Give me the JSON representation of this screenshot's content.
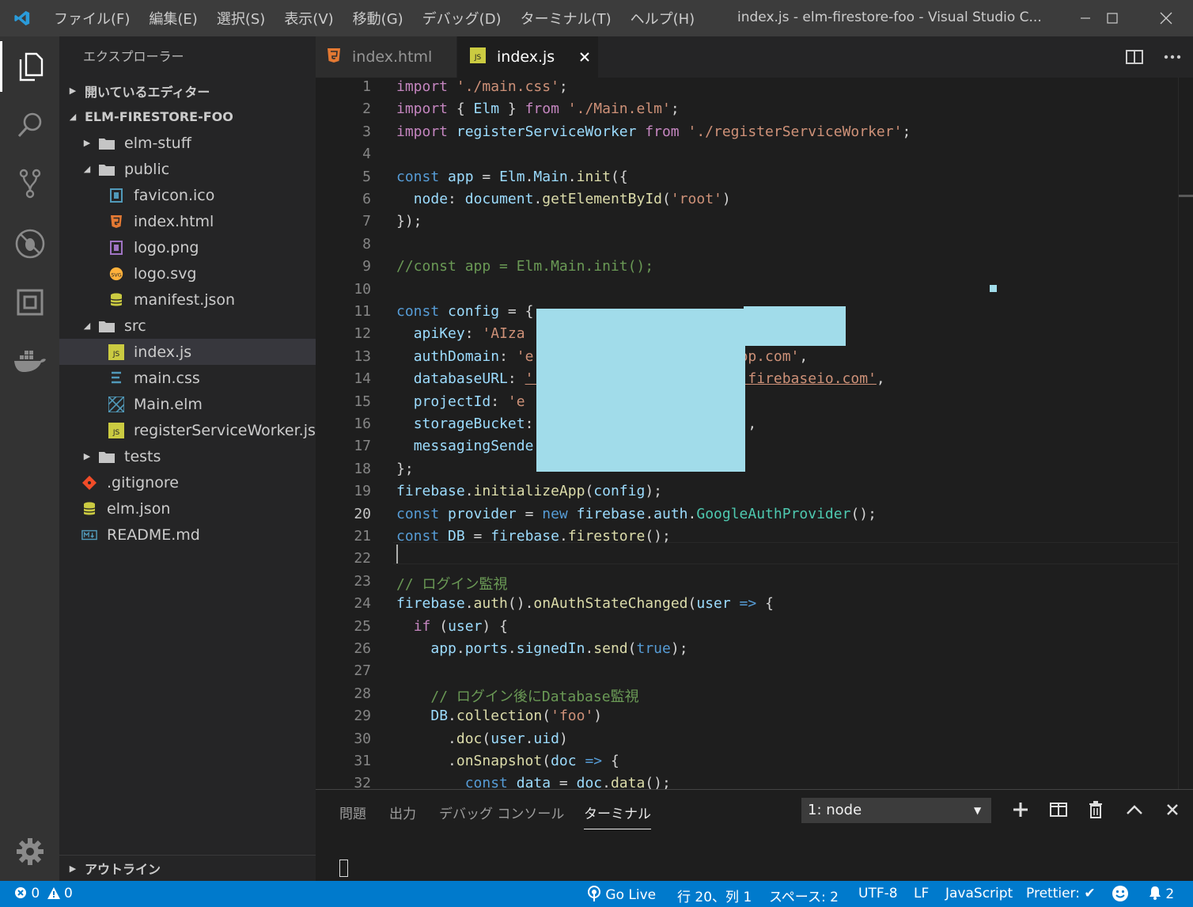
{
  "titlebar": {
    "menu": [
      "ファイル(F)",
      "編集(E)",
      "選択(S)",
      "表示(V)",
      "移動(G)",
      "デバッグ(D)",
      "ターミナル(T)",
      "ヘルプ(H)"
    ],
    "window_title": "index.js - elm-firestore-foo - Visual Studio C..."
  },
  "sidebar": {
    "header": "エクスプローラー",
    "open_editors": "開いているエディター",
    "project": "ELM-FIRESTORE-FOO",
    "tree": [
      {
        "label": "elm-stuff",
        "type": "folder",
        "expanded": false,
        "depth": 0
      },
      {
        "label": "public",
        "type": "folder",
        "expanded": true,
        "depth": 0
      },
      {
        "label": "favicon.ico",
        "type": "ico",
        "depth": 1
      },
      {
        "label": "index.html",
        "type": "html",
        "depth": 1
      },
      {
        "label": "logo.png",
        "type": "png",
        "depth": 1
      },
      {
        "label": "logo.svg",
        "type": "svg",
        "depth": 1
      },
      {
        "label": "manifest.json",
        "type": "json",
        "depth": 1
      },
      {
        "label": "src",
        "type": "folder",
        "expanded": true,
        "depth": 0
      },
      {
        "label": "index.js",
        "type": "js",
        "depth": 1,
        "selected": true
      },
      {
        "label": "main.css",
        "type": "css",
        "depth": 1
      },
      {
        "label": "Main.elm",
        "type": "elm",
        "depth": 1
      },
      {
        "label": "registerServiceWorker.js",
        "type": "js",
        "depth": 1
      },
      {
        "label": "tests",
        "type": "folder",
        "expanded": false,
        "depth": 0
      },
      {
        "label": ".gitignore",
        "type": "git",
        "depth": 0
      },
      {
        "label": "elm.json",
        "type": "json",
        "depth": 0
      },
      {
        "label": "README.md",
        "type": "md",
        "depth": 0
      }
    ],
    "outline": "アウトライン"
  },
  "tabs": [
    {
      "label": "index.html",
      "active": false
    },
    {
      "label": "index.js",
      "active": true
    }
  ],
  "code": {
    "current_line": 20,
    "lines": [
      [
        [
          "kk",
          "import"
        ],
        [
          "p",
          " "
        ],
        [
          "s",
          "'./main.css'"
        ],
        [
          "p",
          ";"
        ]
      ],
      [
        [
          "kk",
          "import"
        ],
        [
          "p",
          " { "
        ],
        [
          "v",
          "Elm"
        ],
        [
          "p",
          " } "
        ],
        [
          "kk",
          "from"
        ],
        [
          "p",
          " "
        ],
        [
          "s",
          "'./Main.elm'"
        ],
        [
          "p",
          ";"
        ]
      ],
      [
        [
          "kk",
          "import"
        ],
        [
          "p",
          " "
        ],
        [
          "v",
          "registerServiceWorker"
        ],
        [
          "p",
          " "
        ],
        [
          "kk",
          "from"
        ],
        [
          "p",
          " "
        ],
        [
          "s",
          "'./registerServiceWorker'"
        ],
        [
          "p",
          ";"
        ]
      ],
      [],
      [
        [
          "k",
          "const"
        ],
        [
          "p",
          " "
        ],
        [
          "v",
          "app"
        ],
        [
          "p",
          " = "
        ],
        [
          "v",
          "Elm"
        ],
        [
          "p",
          "."
        ],
        [
          "v",
          "Main"
        ],
        [
          "p",
          "."
        ],
        [
          "f",
          "init"
        ],
        [
          "p",
          "({"
        ]
      ],
      [
        [
          "p",
          "  "
        ],
        [
          "v",
          "node"
        ],
        [
          "p",
          ": "
        ],
        [
          "v",
          "document"
        ],
        [
          "p",
          "."
        ],
        [
          "f",
          "getElementById"
        ],
        [
          "p",
          "("
        ],
        [
          "s",
          "'root'"
        ],
        [
          "p",
          ")"
        ]
      ],
      [
        [
          "p",
          "});"
        ]
      ],
      [],
      [
        [
          "c",
          "//const app = Elm.Main.init();"
        ]
      ],
      [],
      [
        [
          "k",
          "const"
        ],
        [
          "p",
          " "
        ],
        [
          "v",
          "config"
        ],
        [
          "p",
          " = {"
        ]
      ],
      [
        [
          "p",
          "  "
        ],
        [
          "v",
          "apiKey"
        ],
        [
          "p",
          ": "
        ],
        [
          "s",
          "'AIza                                  o'"
        ],
        [
          "p",
          ","
        ]
      ],
      [
        [
          "p",
          "  "
        ],
        [
          "v",
          "authDomain"
        ],
        [
          "p",
          ": "
        ],
        [
          "s",
          "'e                       app.com'"
        ],
        [
          "p",
          ","
        ]
      ],
      [
        [
          "p",
          "  "
        ],
        [
          "v",
          "databaseURL"
        ],
        [
          "p",
          ": "
        ],
        [
          "su",
          "'                        .firebaseio.com'"
        ],
        [
          "p",
          ","
        ]
      ],
      [
        [
          "p",
          "  "
        ],
        [
          "v",
          "projectId"
        ],
        [
          "p",
          ": "
        ],
        [
          "s",
          "'e"
        ]
      ],
      [
        [
          "p",
          "  "
        ],
        [
          "v",
          "storageBucket"
        ],
        [
          "p",
          ":                  "
        ],
        [
          "s",
          "ot.com'"
        ],
        [
          "p",
          ","
        ]
      ],
      [
        [
          "p",
          "  "
        ],
        [
          "v",
          "messagingSende"
        ]
      ],
      [
        [
          "p",
          "};"
        ]
      ],
      [
        [
          "v",
          "firebase"
        ],
        [
          "p",
          "."
        ],
        [
          "f",
          "initializeApp"
        ],
        [
          "p",
          "("
        ],
        [
          "v",
          "config"
        ],
        [
          "p",
          ");"
        ]
      ],
      [
        [
          "k",
          "const"
        ],
        [
          "p",
          " "
        ],
        [
          "v",
          "provider"
        ],
        [
          "p",
          " = "
        ],
        [
          "k",
          "new"
        ],
        [
          "p",
          " "
        ],
        [
          "v",
          "firebase"
        ],
        [
          "p",
          "."
        ],
        [
          "v",
          "auth"
        ],
        [
          "p",
          "."
        ],
        [
          "t",
          "GoogleAuthProvider"
        ],
        [
          "p",
          "();"
        ]
      ],
      [
        [
          "k",
          "const"
        ],
        [
          "p",
          " "
        ],
        [
          "v",
          "DB"
        ],
        [
          "p",
          " = "
        ],
        [
          "v",
          "firebase"
        ],
        [
          "p",
          "."
        ],
        [
          "f",
          "firestore"
        ],
        [
          "p",
          "();"
        ]
      ],
      [],
      [
        [
          "c",
          "// ログイン監視"
        ]
      ],
      [
        [
          "v",
          "firebase"
        ],
        [
          "p",
          "."
        ],
        [
          "f",
          "auth"
        ],
        [
          "p",
          "()."
        ],
        [
          "f",
          "onAuthStateChanged"
        ],
        [
          "p",
          "("
        ],
        [
          "v",
          "user"
        ],
        [
          "p",
          " "
        ],
        [
          "k",
          "=>"
        ],
        [
          "p",
          " {"
        ]
      ],
      [
        [
          "p",
          "  "
        ],
        [
          "kk",
          "if"
        ],
        [
          "p",
          " ("
        ],
        [
          "v",
          "user"
        ],
        [
          "p",
          ") {"
        ]
      ],
      [
        [
          "p",
          "    "
        ],
        [
          "v",
          "app"
        ],
        [
          "p",
          "."
        ],
        [
          "v",
          "ports"
        ],
        [
          "p",
          "."
        ],
        [
          "v",
          "signedIn"
        ],
        [
          "p",
          "."
        ],
        [
          "f",
          "send"
        ],
        [
          "p",
          "("
        ],
        [
          "k",
          "true"
        ],
        [
          "p",
          ");"
        ]
      ],
      [],
      [
        [
          "p",
          "    "
        ],
        [
          "c",
          "// ログイン後にDatabase監視"
        ]
      ],
      [
        [
          "p",
          "    "
        ],
        [
          "v",
          "DB"
        ],
        [
          "p",
          "."
        ],
        [
          "f",
          "collection"
        ],
        [
          "p",
          "("
        ],
        [
          "s",
          "'foo'"
        ],
        [
          "p",
          ")"
        ]
      ],
      [
        [
          "p",
          "      ."
        ],
        [
          "f",
          "doc"
        ],
        [
          "p",
          "("
        ],
        [
          "v",
          "user"
        ],
        [
          "p",
          "."
        ],
        [
          "v",
          "uid"
        ],
        [
          "p",
          ")"
        ]
      ],
      [
        [
          "p",
          "      ."
        ],
        [
          "f",
          "onSnapshot"
        ],
        [
          "p",
          "("
        ],
        [
          "v",
          "doc"
        ],
        [
          "p",
          " "
        ],
        [
          "k",
          "=>"
        ],
        [
          "p",
          " {"
        ]
      ],
      [
        [
          "p",
          "        "
        ],
        [
          "k",
          "const"
        ],
        [
          "p",
          " "
        ],
        [
          "v",
          "data"
        ],
        [
          "p",
          " = "
        ],
        [
          "v",
          "doc"
        ],
        [
          "p",
          "."
        ],
        [
          "f",
          "data"
        ],
        [
          "p",
          "();"
        ]
      ]
    ]
  },
  "panel": {
    "tabs": [
      "問題",
      "出力",
      "デバッグ コンソール",
      "ターミナル"
    ],
    "active_tab": "ターミナル",
    "terminal_select": "1: node",
    "terminal_select_arrow": "▼"
  },
  "statusbar": {
    "errors": "0",
    "warnings": "0",
    "go_live": "Go Live",
    "position": "行 20、列 1",
    "spaces": "スペース: 2",
    "encoding": "UTF-8",
    "eol": "LF",
    "language": "JavaScript",
    "prettier": "Prettier: ✔",
    "notifications": "2"
  },
  "colors": {
    "accent": "#007acc",
    "redaction": "#a1dcea"
  }
}
